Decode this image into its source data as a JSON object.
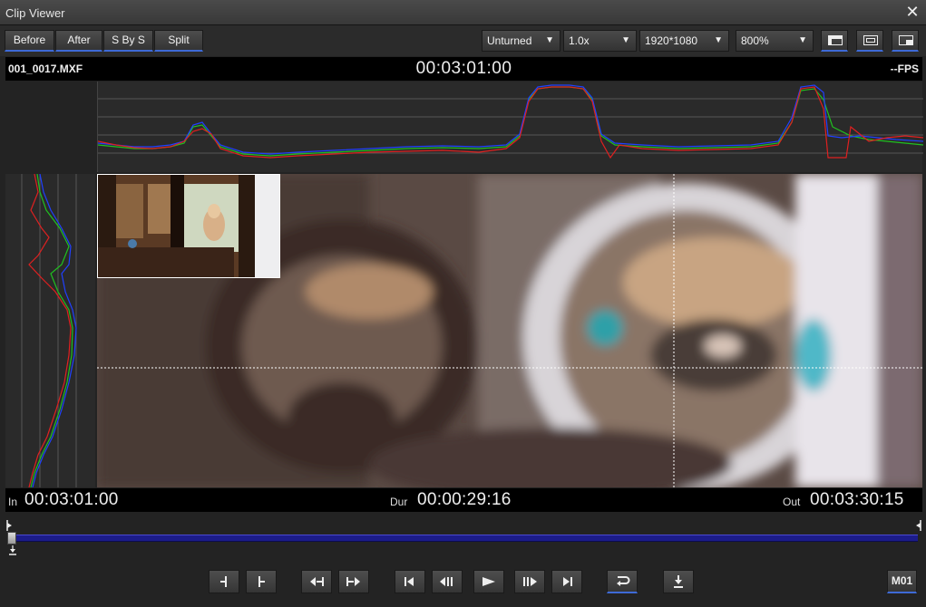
{
  "window": {
    "title": "Clip Viewer"
  },
  "toolbar": {
    "view_modes": [
      {
        "label": "Before"
      },
      {
        "label": "After"
      },
      {
        "label": "S By S"
      },
      {
        "label": "Split"
      }
    ],
    "rotation": "Unturned",
    "speed": "1.0x",
    "resolution": "1920*1080",
    "zoom": "800%"
  },
  "info": {
    "clip_name": "001_0017.MXF",
    "current_timecode": "00:03:01:00",
    "fps": "--FPS"
  },
  "timecodes": {
    "in_label": "In",
    "in_value": "00:03:01:00",
    "dur_label": "Dur",
    "dur_value": "00:00:29:16",
    "out_label": "Out",
    "out_value": "00:03:30:15"
  },
  "scrub": {
    "position": 0.0
  },
  "transport": {
    "m01_label": "M01"
  },
  "colors": {
    "accent": "#3e6ad6",
    "wave_red": "#e02020",
    "wave_green": "#20c020",
    "wave_blue": "#2040ff"
  }
}
